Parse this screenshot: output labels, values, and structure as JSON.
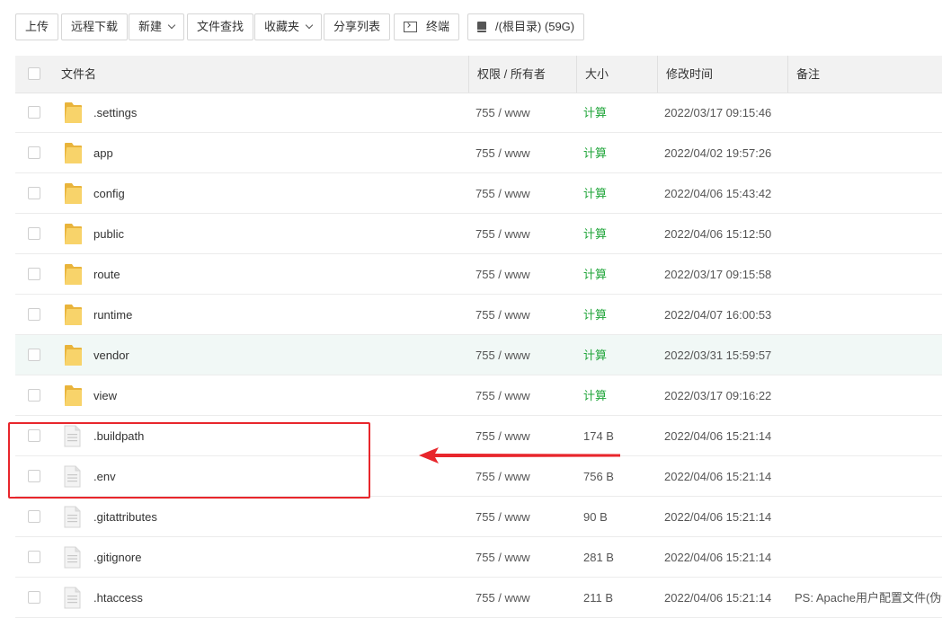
{
  "toolbar": {
    "upload": "上传",
    "remote_download": "远程下载",
    "new": "新建",
    "file_search": "文件查找",
    "favorites": "收藏夹",
    "share_list": "分享列表",
    "terminal": "终端",
    "path": "/(根目录) (59G)"
  },
  "table": {
    "headers": {
      "name": "文件名",
      "permission": "权限 / 所有者",
      "size": "大小",
      "modified": "修改时间",
      "note": "备注"
    },
    "rows": [
      {
        "name": ".settings",
        "type": "folder",
        "perm": "755 / www",
        "size": "计算",
        "time": "2022/03/17 09:15:46",
        "note": ""
      },
      {
        "name": "app",
        "type": "folder",
        "perm": "755 / www",
        "size": "计算",
        "time": "2022/04/02 19:57:26",
        "note": ""
      },
      {
        "name": "config",
        "type": "folder",
        "perm": "755 / www",
        "size": "计算",
        "time": "2022/04/06 15:43:42",
        "note": ""
      },
      {
        "name": "public",
        "type": "folder",
        "perm": "755 / www",
        "size": "计算",
        "time": "2022/04/06 15:12:50",
        "note": ""
      },
      {
        "name": "route",
        "type": "folder",
        "perm": "755 / www",
        "size": "计算",
        "time": "2022/03/17 09:15:58",
        "note": ""
      },
      {
        "name": "runtime",
        "type": "folder",
        "perm": "755 / www",
        "size": "计算",
        "time": "2022/04/07 16:00:53",
        "note": ""
      },
      {
        "name": "vendor",
        "type": "folder",
        "perm": "755 / www",
        "size": "计算",
        "time": "2022/03/31 15:59:57",
        "note": ""
      },
      {
        "name": "view",
        "type": "folder",
        "perm": "755 / www",
        "size": "计算",
        "time": "2022/03/17 09:16:22",
        "note": ""
      },
      {
        "name": ".buildpath",
        "type": "file",
        "perm": "755 / www",
        "size": "174 B",
        "time": "2022/04/06 15:21:14",
        "note": ""
      },
      {
        "name": ".env",
        "type": "file",
        "perm": "755 / www",
        "size": "756 B",
        "time": "2022/04/06 15:21:14",
        "note": ""
      },
      {
        "name": ".gitattributes",
        "type": "file",
        "perm": "755 / www",
        "size": "90 B",
        "time": "2022/04/06 15:21:14",
        "note": ""
      },
      {
        "name": ".gitignore",
        "type": "file",
        "perm": "755 / www",
        "size": "281 B",
        "time": "2022/04/06 15:21:14",
        "note": ""
      },
      {
        "name": ".htaccess",
        "type": "file",
        "perm": "755 / www",
        "size": "211 B",
        "time": "2022/04/06 15:21:14",
        "note": "PS: Apache用户配置文件(伪静"
      }
    ]
  },
  "colors": {
    "accent_green": "#20a53a",
    "annotation_red": "#e8262c",
    "folder_yellow": "#f5c542",
    "row_highlight": "#f1f8f6"
  },
  "annotation": {
    "highlighted_rows": [
      ".buildpath",
      ".env"
    ],
    "icon": "red-arrow-icon"
  }
}
